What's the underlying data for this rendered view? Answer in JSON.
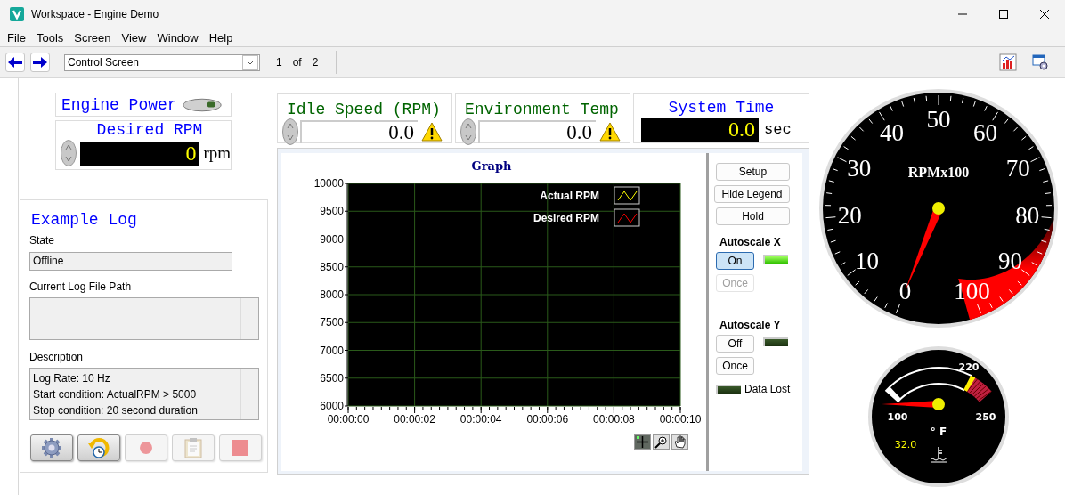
{
  "window": {
    "title": "Workspace - Engine Demo"
  },
  "menu": [
    "File",
    "Tools",
    "Screen",
    "View",
    "Window",
    "Help"
  ],
  "toolbar": {
    "screen_select": "Control Screen",
    "page": "1",
    "of": "of",
    "total": "2"
  },
  "engine_power": {
    "label": "Engine Power",
    "on": false
  },
  "desired_rpm": {
    "label": "Desired RPM",
    "value": "0",
    "unit": "rpm"
  },
  "indicators": [
    {
      "label": "Idle Speed (RPM)",
      "value": "0.0",
      "warning": true
    },
    {
      "label": "Environment Temp",
      "value": "0.0",
      "warning": true
    }
  ],
  "system_time": {
    "label": "System Time",
    "value": "0.0",
    "unit": "sec"
  },
  "log": {
    "title": "Example Log",
    "state_label": "State",
    "state": "Offline",
    "path_label": "Current Log File Path",
    "description_label": "Description",
    "description": [
      "Log Rate: 10 Hz",
      "Start condition: ActualRPM > 5000",
      "Stop condition: 20 second duration"
    ],
    "buttons": [
      {
        "kind": "settings",
        "disabled": false
      },
      {
        "kind": "schedule",
        "disabled": false
      },
      {
        "kind": "record",
        "disabled": true
      },
      {
        "kind": "clipboard",
        "disabled": true
      },
      {
        "kind": "stop",
        "disabled": true
      }
    ]
  },
  "graph": {
    "chart_data": {
      "type": "line",
      "title": "Graph",
      "series": [
        {
          "name": "Actual RPM",
          "color": "#ffff00",
          "values": [
            null,
            null,
            null,
            null,
            null,
            null
          ]
        },
        {
          "name": "Desired RPM",
          "color": "#ff0000",
          "values": [
            null,
            null,
            null,
            null,
            null,
            null
          ]
        }
      ],
      "categories": [
        "00:00:00",
        "00:00:02",
        "00:00:04",
        "00:00:06",
        "00:00:08",
        "00:00:10"
      ],
      "ylim": [
        6000,
        10000
      ],
      "grid": true,
      "yticks": [
        6000,
        6500,
        7000,
        7500,
        8000,
        8500,
        9000,
        9500,
        10000
      ]
    },
    "tools": [
      {
        "kind": "cursor",
        "selected": true
      },
      {
        "kind": "zoom",
        "selected": false
      },
      {
        "kind": "pan",
        "selected": false
      }
    ]
  },
  "graph_controls": {
    "buttons": [
      {
        "label": "Setup"
      },
      {
        "label": "Hide Legend"
      },
      {
        "label": "Hold"
      }
    ],
    "autoscale": [
      {
        "label": "Autoscale X",
        "toggle": "On",
        "toggle_selected": true,
        "once": "Once",
        "once_disabled": true,
        "led_on": true
      },
      {
        "label": "Autoscale Y",
        "toggle": "Off",
        "toggle_selected": false,
        "once": "Once",
        "once_disabled": false,
        "led_on": false
      }
    ],
    "data_lost": {
      "label": "Data Lost",
      "led_on": false
    }
  },
  "gauges": {
    "rpm": {
      "caption": "RPMx100",
      "labels": [
        "0",
        "10",
        "20",
        "30",
        "40",
        "50",
        "60",
        "70",
        "80",
        "90",
        "100"
      ]
    },
    "temp": {
      "labels": [
        "100",
        "220",
        "250"
      ],
      "unit": "° F",
      "readout": "32.0"
    }
  }
}
